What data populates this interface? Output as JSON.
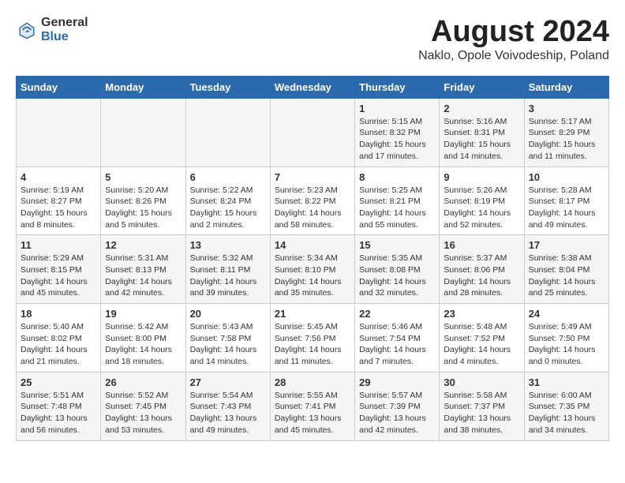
{
  "header": {
    "logo_general": "General",
    "logo_blue": "Blue",
    "month_title": "August 2024",
    "location": "Naklo, Opole Voivodeship, Poland"
  },
  "weekdays": [
    "Sunday",
    "Monday",
    "Tuesday",
    "Wednesday",
    "Thursday",
    "Friday",
    "Saturday"
  ],
  "weeks": [
    [
      {
        "day": "",
        "info": ""
      },
      {
        "day": "",
        "info": ""
      },
      {
        "day": "",
        "info": ""
      },
      {
        "day": "",
        "info": ""
      },
      {
        "day": "1",
        "info": "Sunrise: 5:15 AM\nSunset: 8:32 PM\nDaylight: 15 hours\nand 17 minutes."
      },
      {
        "day": "2",
        "info": "Sunrise: 5:16 AM\nSunset: 8:31 PM\nDaylight: 15 hours\nand 14 minutes."
      },
      {
        "day": "3",
        "info": "Sunrise: 5:17 AM\nSunset: 8:29 PM\nDaylight: 15 hours\nand 11 minutes."
      }
    ],
    [
      {
        "day": "4",
        "info": "Sunrise: 5:19 AM\nSunset: 8:27 PM\nDaylight: 15 hours\nand 8 minutes."
      },
      {
        "day": "5",
        "info": "Sunrise: 5:20 AM\nSunset: 8:26 PM\nDaylight: 15 hours\nand 5 minutes."
      },
      {
        "day": "6",
        "info": "Sunrise: 5:22 AM\nSunset: 8:24 PM\nDaylight: 15 hours\nand 2 minutes."
      },
      {
        "day": "7",
        "info": "Sunrise: 5:23 AM\nSunset: 8:22 PM\nDaylight: 14 hours\nand 58 minutes."
      },
      {
        "day": "8",
        "info": "Sunrise: 5:25 AM\nSunset: 8:21 PM\nDaylight: 14 hours\nand 55 minutes."
      },
      {
        "day": "9",
        "info": "Sunrise: 5:26 AM\nSunset: 8:19 PM\nDaylight: 14 hours\nand 52 minutes."
      },
      {
        "day": "10",
        "info": "Sunrise: 5:28 AM\nSunset: 8:17 PM\nDaylight: 14 hours\nand 49 minutes."
      }
    ],
    [
      {
        "day": "11",
        "info": "Sunrise: 5:29 AM\nSunset: 8:15 PM\nDaylight: 14 hours\nand 45 minutes."
      },
      {
        "day": "12",
        "info": "Sunrise: 5:31 AM\nSunset: 8:13 PM\nDaylight: 14 hours\nand 42 minutes."
      },
      {
        "day": "13",
        "info": "Sunrise: 5:32 AM\nSunset: 8:11 PM\nDaylight: 14 hours\nand 39 minutes."
      },
      {
        "day": "14",
        "info": "Sunrise: 5:34 AM\nSunset: 8:10 PM\nDaylight: 14 hours\nand 35 minutes."
      },
      {
        "day": "15",
        "info": "Sunrise: 5:35 AM\nSunset: 8:08 PM\nDaylight: 14 hours\nand 32 minutes."
      },
      {
        "day": "16",
        "info": "Sunrise: 5:37 AM\nSunset: 8:06 PM\nDaylight: 14 hours\nand 28 minutes."
      },
      {
        "day": "17",
        "info": "Sunrise: 5:38 AM\nSunset: 8:04 PM\nDaylight: 14 hours\nand 25 minutes."
      }
    ],
    [
      {
        "day": "18",
        "info": "Sunrise: 5:40 AM\nSunset: 8:02 PM\nDaylight: 14 hours\nand 21 minutes."
      },
      {
        "day": "19",
        "info": "Sunrise: 5:42 AM\nSunset: 8:00 PM\nDaylight: 14 hours\nand 18 minutes."
      },
      {
        "day": "20",
        "info": "Sunrise: 5:43 AM\nSunset: 7:58 PM\nDaylight: 14 hours\nand 14 minutes."
      },
      {
        "day": "21",
        "info": "Sunrise: 5:45 AM\nSunset: 7:56 PM\nDaylight: 14 hours\nand 11 minutes."
      },
      {
        "day": "22",
        "info": "Sunrise: 5:46 AM\nSunset: 7:54 PM\nDaylight: 14 hours\nand 7 minutes."
      },
      {
        "day": "23",
        "info": "Sunrise: 5:48 AM\nSunset: 7:52 PM\nDaylight: 14 hours\nand 4 minutes."
      },
      {
        "day": "24",
        "info": "Sunrise: 5:49 AM\nSunset: 7:50 PM\nDaylight: 14 hours\nand 0 minutes."
      }
    ],
    [
      {
        "day": "25",
        "info": "Sunrise: 5:51 AM\nSunset: 7:48 PM\nDaylight: 13 hours\nand 56 minutes."
      },
      {
        "day": "26",
        "info": "Sunrise: 5:52 AM\nSunset: 7:45 PM\nDaylight: 13 hours\nand 53 minutes."
      },
      {
        "day": "27",
        "info": "Sunrise: 5:54 AM\nSunset: 7:43 PM\nDaylight: 13 hours\nand 49 minutes."
      },
      {
        "day": "28",
        "info": "Sunrise: 5:55 AM\nSunset: 7:41 PM\nDaylight: 13 hours\nand 45 minutes."
      },
      {
        "day": "29",
        "info": "Sunrise: 5:57 AM\nSunset: 7:39 PM\nDaylight: 13 hours\nand 42 minutes."
      },
      {
        "day": "30",
        "info": "Sunrise: 5:58 AM\nSunset: 7:37 PM\nDaylight: 13 hours\nand 38 minutes."
      },
      {
        "day": "31",
        "info": "Sunrise: 6:00 AM\nSunset: 7:35 PM\nDaylight: 13 hours\nand 34 minutes."
      }
    ]
  ]
}
